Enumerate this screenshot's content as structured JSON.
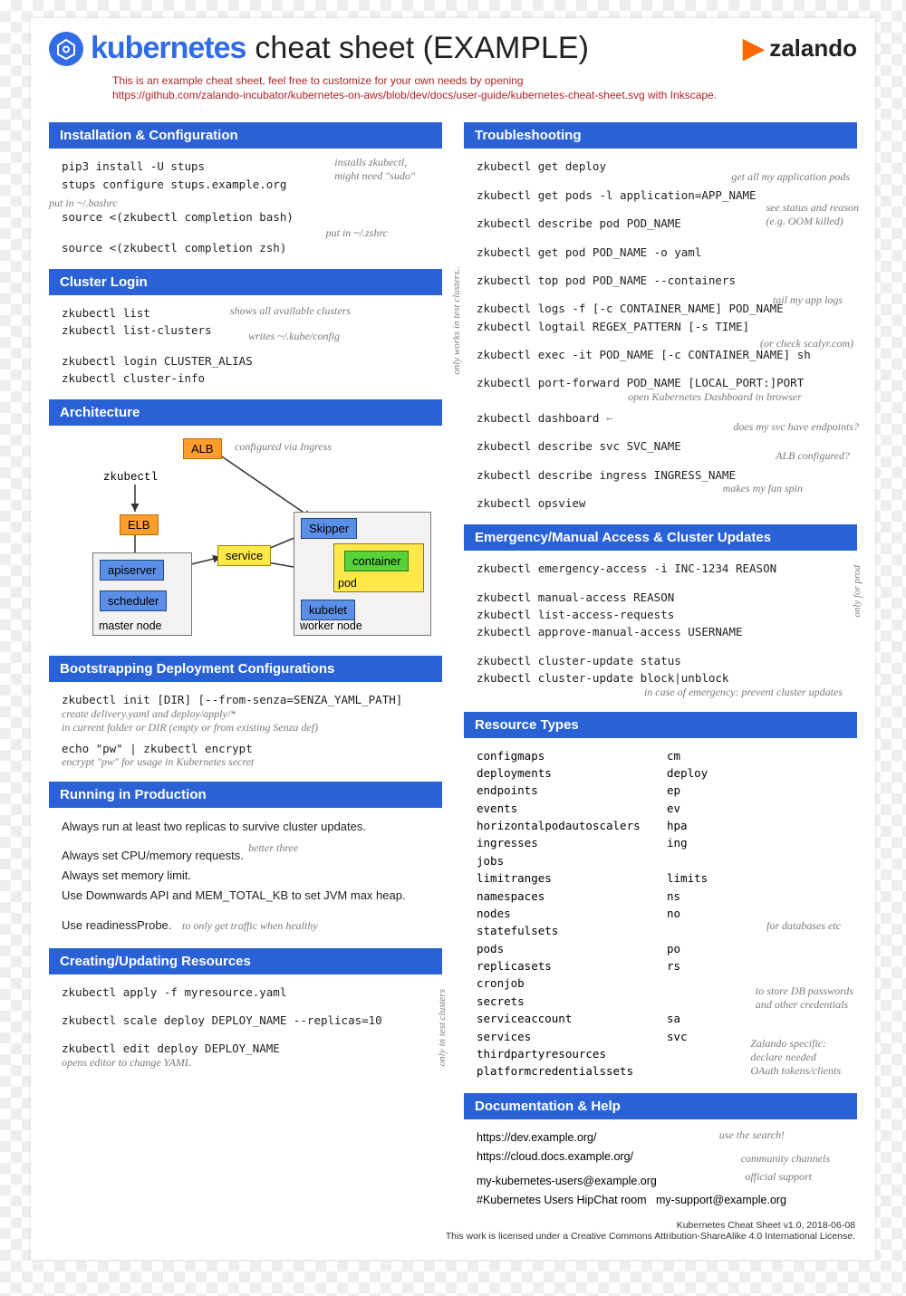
{
  "header": {
    "logo_word": "kubernetes",
    "title": "cheat sheet (EXAMPLE)",
    "vendor": "zalando",
    "intro_line1": "This is an example cheat sheet, feel free to customize for your own needs by opening",
    "intro_line2": "https://github.com/zalando-incubator/kubernetes-on-aws/blob/dev/docs/user-guide/kubernetes-cheat-sheet.svg with Inkscape."
  },
  "left": {
    "install": {
      "h": "Installation & Configuration",
      "c1": "pip3 install -U stups",
      "c2": "stups configure stups.example.org",
      "n1": "installs zkubectl,\nmight need \"sudo\"",
      "n2": "put in ~/.bashrc",
      "c3": "source <(zkubectl completion bash)",
      "n3": "put in ~/.zshrc",
      "c4": "source <(zkubectl completion zsh)"
    },
    "login": {
      "h": "Cluster Login",
      "c1": "zkubectl list",
      "c2": "zkubectl list-clusters",
      "n1": "shows all available clusters",
      "n2": "writes ~/.kube/config",
      "c3": "zkubectl login CLUSTER_ALIAS",
      "c4": "zkubectl cluster-info"
    },
    "arch": {
      "h": "Architecture",
      "alb": "ALB",
      "elb": "ELB",
      "apiserver": "apiserver",
      "scheduler": "scheduler",
      "master": "master node",
      "worker": "worker node",
      "skipper": "Skipper",
      "service": "service",
      "container": "container",
      "pod": "pod",
      "kubelet": "kubelet",
      "zk": "zkubectl",
      "n1": "configured via Ingress"
    },
    "boot": {
      "h": "Bootstrapping Deployment Configurations",
      "c1": "zkubectl init [DIR] [--from-senza=SENZA_YAML_PATH]",
      "n1": "create delivery.yaml and deploy/apply/*\nin current folder or DIR (empty or from existing Senza def)",
      "c2": "echo \"pw\" | zkubectl encrypt",
      "n2": "encrypt \"pw\" for usage in Kubernetes secret"
    },
    "run": {
      "h": "Running in Production",
      "t1": "Always run at least two replicas to survive cluster updates.",
      "t2": "Always set CPU/memory requests.",
      "t3": "Always set memory limit.",
      "t4": "Use Downwards API and MEM_TOTAL_KB to set JVM max heap.",
      "t5": "Use readinessProbe.",
      "n1": "better three",
      "n2": "to only get traffic when healthy"
    },
    "create": {
      "h": "Creating/Updating Resources",
      "c1": "zkubectl apply -f myresource.yaml",
      "c2": "zkubectl scale deploy DEPLOY_NAME --replicas=10",
      "c3": "zkubectl edit deploy DEPLOY_NAME",
      "n1": "opens editor to change YAML",
      "side": "only in test clusters"
    }
  },
  "right": {
    "trouble": {
      "h": "Troubleshooting",
      "c1": "zkubectl get deploy",
      "n1": "get all my application pods",
      "c2": "zkubectl get pods -l application=APP_NAME",
      "n2": "see status and reason\n(e.g. OOM killed)",
      "c3": "zkubectl describe pod POD_NAME",
      "c4": "zkubectl get pod POD_NAME -o yaml",
      "c5": "zkubectl top pod POD_NAME --containers",
      "n3": "tail my app logs",
      "c6": "zkubectl logs -f [-c CONTAINER_NAME] POD_NAME",
      "c7": "zkubectl logtail REGEX_PATTERN [-s TIME]",
      "n4": "(or check scalyr.com)",
      "c8": "zkubectl exec -it POD_NAME [-c CONTAINER_NAME] sh",
      "c9": "zkubectl port-forward POD_NAME [LOCAL_PORT:]PORT",
      "n5": "open Kubernetes Dashboard in browser",
      "c10": "zkubectl dashboard",
      "n6": "does my svc have endpoints?",
      "c11": "zkubectl describe svc SVC_NAME",
      "n7": "ALB configured?",
      "c12": "zkubectl describe ingress INGRESS_NAME",
      "n8": "makes my fan spin",
      "c13": "zkubectl opsview",
      "side": "only works in test clusters.."
    },
    "emerg": {
      "h": "Emergency/Manual Access & Cluster Updates",
      "c1": "zkubectl emergency-access -i INC-1234 REASON",
      "c2": "zkubectl manual-access REASON",
      "c3": "zkubectl list-access-requests",
      "c4": "zkubectl approve-manual-access USERNAME",
      "c5": "zkubectl cluster-update status",
      "c6": "zkubectl cluster-update block|unblock",
      "n1": "in case of emergency: prevent cluster updates",
      "side": "only for prod"
    },
    "res": {
      "h": "Resource Types",
      "items": [
        {
          "a": "configmaps",
          "b": "cm"
        },
        {
          "a": "deployments",
          "b": "deploy"
        },
        {
          "a": "endpoints",
          "b": "ep"
        },
        {
          "a": "events",
          "b": "ev"
        },
        {
          "a": "horizontalpodautoscalers",
          "b": "hpa"
        },
        {
          "a": "ingresses",
          "b": "ing"
        },
        {
          "a": "jobs",
          "b": ""
        },
        {
          "a": "limitranges",
          "b": "limits"
        },
        {
          "a": "namespaces",
          "b": "ns"
        },
        {
          "a": "nodes",
          "b": "no"
        },
        {
          "a": "statefulsets",
          "b": ""
        },
        {
          "a": "pods",
          "b": "po"
        },
        {
          "a": "replicasets",
          "b": "rs"
        },
        {
          "a": "cronjob",
          "b": ""
        },
        {
          "a": "secrets",
          "b": ""
        },
        {
          "a": "serviceaccount",
          "b": "sa"
        },
        {
          "a": "services",
          "b": "svc"
        },
        {
          "a": "thirdpartyresources",
          "b": ""
        },
        {
          "a": "platformcredentialssets",
          "b": ""
        }
      ],
      "n1": "for databases etc",
      "n2": "to store DB passwords\nand other credentials",
      "n3": "Zalando specific:\ndeclare needed\nOAuth tokens/clients"
    },
    "doc": {
      "h": "Documentation & Help",
      "l1": "https://dev.example.org/",
      "l2": "https://cloud.docs.example.org/",
      "l3": "my-kubernetes-users@example.org",
      "l4": "#Kubernetes Users HipChat room",
      "l5": "my-support@example.org",
      "n1": "use the search!",
      "n2": "community channels",
      "n3": "official support"
    }
  },
  "footer": {
    "f1": "Kubernetes Cheat Sheet v1.0, 2018-06-08",
    "f2": "This work is licensed under a Creative Commons Attribution-ShareAlike 4.0 International License."
  }
}
